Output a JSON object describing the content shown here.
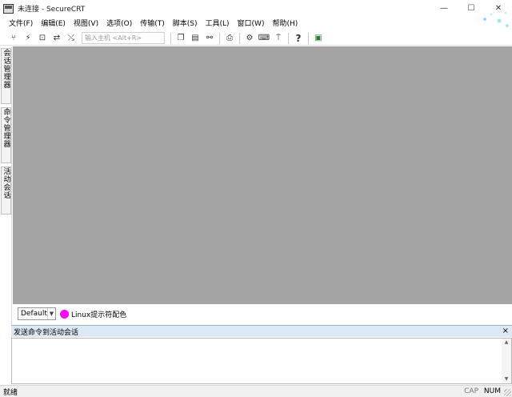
{
  "window": {
    "title": "未连接 - SecureCRT",
    "minimize_glyph": "—",
    "maximize_glyph": "☐",
    "close_glyph": "✕"
  },
  "menu": [
    {
      "label": "文件(F)"
    },
    {
      "label": "编辑(E)"
    },
    {
      "label": "视图(V)"
    },
    {
      "label": "选项(O)"
    },
    {
      "label": "传输(T)"
    },
    {
      "label": "脚本(S)"
    },
    {
      "label": "工具(L)"
    },
    {
      "label": "窗口(W)"
    },
    {
      "label": "帮助(H)"
    }
  ],
  "toolbar": {
    "host_placeholder": "输入主机 <Alt+R>",
    "icons": {
      "connect": "⑂",
      "quick_connect": "⚡",
      "local_shell": "⊡",
      "reconnect": "⇄",
      "disconnect": "⤯",
      "copy": "❐",
      "paste": "▤",
      "find": "⚯",
      "print": "⎙",
      "settings": "⚙",
      "keymap": "⌨",
      "sftp": "⍑",
      "help": "?",
      "about": "▣"
    }
  },
  "side_tabs": [
    {
      "label": "会话管理器"
    },
    {
      "label": "命令管理器"
    },
    {
      "label": "活动会话"
    }
  ],
  "color_bar": {
    "scheme_value": "Default",
    "color_label": "Linux提示符配色",
    "dot_color": "#ff00ff"
  },
  "command_window": {
    "title": "发送命令到活动会话",
    "close_glyph": "×"
  },
  "status": {
    "text": "就绪",
    "cap": "CAP",
    "num": "NUM"
  },
  "colors": {
    "terminal_bg": "#a4a4a4",
    "cmd_header_bg": "#dce8f4"
  }
}
